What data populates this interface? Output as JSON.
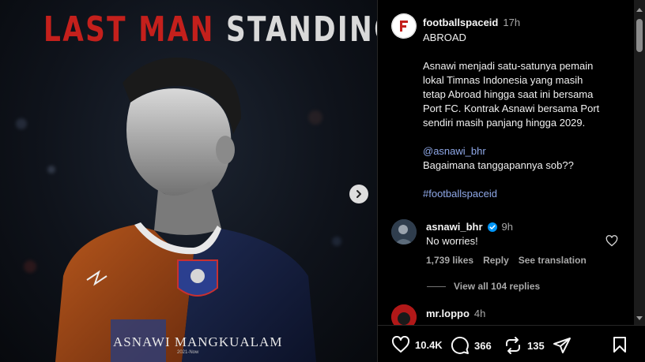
{
  "post_image": {
    "title_word1": "LAST MAN",
    "title_word2": "STANDING",
    "player_name": "ASNAWI MANGKUALAM",
    "years": "2021-Now",
    "next_icon": "chevron-right-icon"
  },
  "post": {
    "username": "footballspaceid",
    "time": "17h",
    "caption_lines": [
      "ABROAD",
      "",
      "Asnawi menjadi satu-satunya pemain",
      "lokal Timnas Indonesia yang masih",
      "tetap Abroad hingga saat ini bersama",
      "Port FC. Kontrak Asnawi bersama Port",
      "sendiri masih panjang hingga 2029.",
      "",
      "@asnawi_bhr",
      "Bagaimana tanggapannya sob??",
      "",
      "#footballspaceid"
    ]
  },
  "comments": [
    {
      "username": "asnawi_bhr",
      "verified": true,
      "time": "9h",
      "text": "No worries!",
      "likes": "1,739 likes",
      "reply_label": "Reply",
      "translate_label": "See translation",
      "view_replies": "View all 104 replies"
    },
    {
      "username": "mr.loppo",
      "time": "4h"
    }
  ],
  "actions": {
    "likes": "10.4K",
    "comments": "366",
    "reposts": "135"
  },
  "colors": {
    "accent_red": "#c4201c",
    "link": "#8fa8e8",
    "verified": "#0095f6",
    "background": "#000000"
  }
}
